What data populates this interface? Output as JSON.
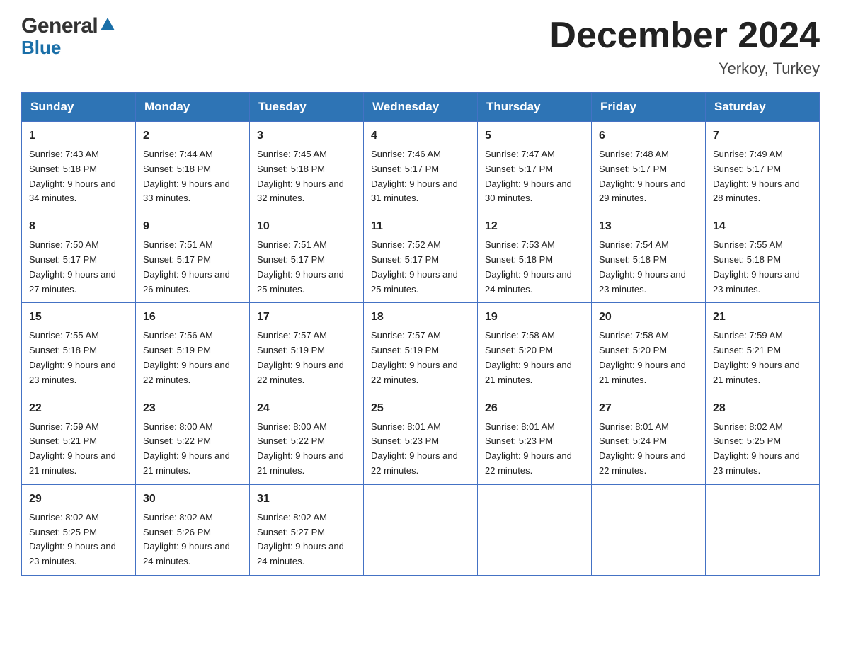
{
  "logo": {
    "general": "General",
    "blue": "Blue",
    "arrow": "▲"
  },
  "header": {
    "month_title": "December 2024",
    "subtitle": "Yerkoy, Turkey"
  },
  "days_of_week": [
    "Sunday",
    "Monday",
    "Tuesday",
    "Wednesday",
    "Thursday",
    "Friday",
    "Saturday"
  ],
  "weeks": [
    [
      {
        "day": "1",
        "sunrise": "Sunrise: 7:43 AM",
        "sunset": "Sunset: 5:18 PM",
        "daylight": "Daylight: 9 hours and 34 minutes."
      },
      {
        "day": "2",
        "sunrise": "Sunrise: 7:44 AM",
        "sunset": "Sunset: 5:18 PM",
        "daylight": "Daylight: 9 hours and 33 minutes."
      },
      {
        "day": "3",
        "sunrise": "Sunrise: 7:45 AM",
        "sunset": "Sunset: 5:18 PM",
        "daylight": "Daylight: 9 hours and 32 minutes."
      },
      {
        "day": "4",
        "sunrise": "Sunrise: 7:46 AM",
        "sunset": "Sunset: 5:17 PM",
        "daylight": "Daylight: 9 hours and 31 minutes."
      },
      {
        "day": "5",
        "sunrise": "Sunrise: 7:47 AM",
        "sunset": "Sunset: 5:17 PM",
        "daylight": "Daylight: 9 hours and 30 minutes."
      },
      {
        "day": "6",
        "sunrise": "Sunrise: 7:48 AM",
        "sunset": "Sunset: 5:17 PM",
        "daylight": "Daylight: 9 hours and 29 minutes."
      },
      {
        "day": "7",
        "sunrise": "Sunrise: 7:49 AM",
        "sunset": "Sunset: 5:17 PM",
        "daylight": "Daylight: 9 hours and 28 minutes."
      }
    ],
    [
      {
        "day": "8",
        "sunrise": "Sunrise: 7:50 AM",
        "sunset": "Sunset: 5:17 PM",
        "daylight": "Daylight: 9 hours and 27 minutes."
      },
      {
        "day": "9",
        "sunrise": "Sunrise: 7:51 AM",
        "sunset": "Sunset: 5:17 PM",
        "daylight": "Daylight: 9 hours and 26 minutes."
      },
      {
        "day": "10",
        "sunrise": "Sunrise: 7:51 AM",
        "sunset": "Sunset: 5:17 PM",
        "daylight": "Daylight: 9 hours and 25 minutes."
      },
      {
        "day": "11",
        "sunrise": "Sunrise: 7:52 AM",
        "sunset": "Sunset: 5:17 PM",
        "daylight": "Daylight: 9 hours and 25 minutes."
      },
      {
        "day": "12",
        "sunrise": "Sunrise: 7:53 AM",
        "sunset": "Sunset: 5:18 PM",
        "daylight": "Daylight: 9 hours and 24 minutes."
      },
      {
        "day": "13",
        "sunrise": "Sunrise: 7:54 AM",
        "sunset": "Sunset: 5:18 PM",
        "daylight": "Daylight: 9 hours and 23 minutes."
      },
      {
        "day": "14",
        "sunrise": "Sunrise: 7:55 AM",
        "sunset": "Sunset: 5:18 PM",
        "daylight": "Daylight: 9 hours and 23 minutes."
      }
    ],
    [
      {
        "day": "15",
        "sunrise": "Sunrise: 7:55 AM",
        "sunset": "Sunset: 5:18 PM",
        "daylight": "Daylight: 9 hours and 23 minutes."
      },
      {
        "day": "16",
        "sunrise": "Sunrise: 7:56 AM",
        "sunset": "Sunset: 5:19 PM",
        "daylight": "Daylight: 9 hours and 22 minutes."
      },
      {
        "day": "17",
        "sunrise": "Sunrise: 7:57 AM",
        "sunset": "Sunset: 5:19 PM",
        "daylight": "Daylight: 9 hours and 22 minutes."
      },
      {
        "day": "18",
        "sunrise": "Sunrise: 7:57 AM",
        "sunset": "Sunset: 5:19 PM",
        "daylight": "Daylight: 9 hours and 22 minutes."
      },
      {
        "day": "19",
        "sunrise": "Sunrise: 7:58 AM",
        "sunset": "Sunset: 5:20 PM",
        "daylight": "Daylight: 9 hours and 21 minutes."
      },
      {
        "day": "20",
        "sunrise": "Sunrise: 7:58 AM",
        "sunset": "Sunset: 5:20 PM",
        "daylight": "Daylight: 9 hours and 21 minutes."
      },
      {
        "day": "21",
        "sunrise": "Sunrise: 7:59 AM",
        "sunset": "Sunset: 5:21 PM",
        "daylight": "Daylight: 9 hours and 21 minutes."
      }
    ],
    [
      {
        "day": "22",
        "sunrise": "Sunrise: 7:59 AM",
        "sunset": "Sunset: 5:21 PM",
        "daylight": "Daylight: 9 hours and 21 minutes."
      },
      {
        "day": "23",
        "sunrise": "Sunrise: 8:00 AM",
        "sunset": "Sunset: 5:22 PM",
        "daylight": "Daylight: 9 hours and 21 minutes."
      },
      {
        "day": "24",
        "sunrise": "Sunrise: 8:00 AM",
        "sunset": "Sunset: 5:22 PM",
        "daylight": "Daylight: 9 hours and 21 minutes."
      },
      {
        "day": "25",
        "sunrise": "Sunrise: 8:01 AM",
        "sunset": "Sunset: 5:23 PM",
        "daylight": "Daylight: 9 hours and 22 minutes."
      },
      {
        "day": "26",
        "sunrise": "Sunrise: 8:01 AM",
        "sunset": "Sunset: 5:23 PM",
        "daylight": "Daylight: 9 hours and 22 minutes."
      },
      {
        "day": "27",
        "sunrise": "Sunrise: 8:01 AM",
        "sunset": "Sunset: 5:24 PM",
        "daylight": "Daylight: 9 hours and 22 minutes."
      },
      {
        "day": "28",
        "sunrise": "Sunrise: 8:02 AM",
        "sunset": "Sunset: 5:25 PM",
        "daylight": "Daylight: 9 hours and 23 minutes."
      }
    ],
    [
      {
        "day": "29",
        "sunrise": "Sunrise: 8:02 AM",
        "sunset": "Sunset: 5:25 PM",
        "daylight": "Daylight: 9 hours and 23 minutes."
      },
      {
        "day": "30",
        "sunrise": "Sunrise: 8:02 AM",
        "sunset": "Sunset: 5:26 PM",
        "daylight": "Daylight: 9 hours and 24 minutes."
      },
      {
        "day": "31",
        "sunrise": "Sunrise: 8:02 AM",
        "sunset": "Sunset: 5:27 PM",
        "daylight": "Daylight: 9 hours and 24 minutes."
      },
      {
        "day": "",
        "sunrise": "",
        "sunset": "",
        "daylight": ""
      },
      {
        "day": "",
        "sunrise": "",
        "sunset": "",
        "daylight": ""
      },
      {
        "day": "",
        "sunrise": "",
        "sunset": "",
        "daylight": ""
      },
      {
        "day": "",
        "sunrise": "",
        "sunset": "",
        "daylight": ""
      }
    ]
  ]
}
